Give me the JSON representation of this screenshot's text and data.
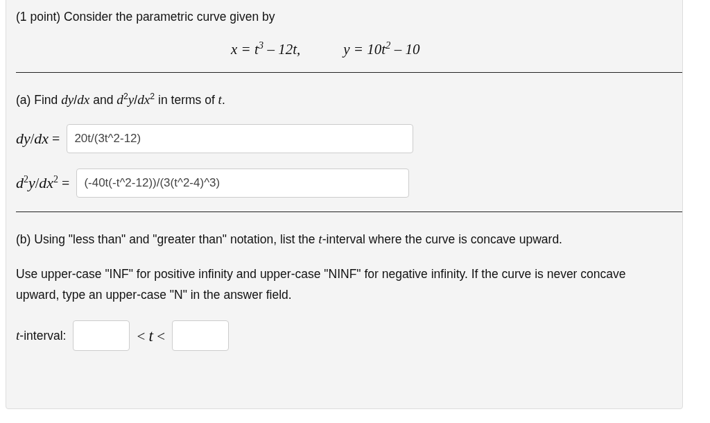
{
  "problem": {
    "intro": "(1 point) Consider the parametric curve given by",
    "equations": [
      "x = t$^{3}$ – 12t,",
      "y = 10t$^{2}$ – 10"
    ]
  },
  "part_a": {
    "prompt": "(a) Find *dy*/*dx* and *d*$^{2}$*y*/*dx*$^{2}$ in terms of *t*.",
    "answers": [
      {
        "label": "*dy*/*dx* =",
        "value": "20t/(3t^2-12)"
      },
      {
        "label": "*d*$^{2}$*y*/*dx*$^{2}$ =",
        "value": "(-40t(-t^2-12))/(3(t^2-4)^3)"
      }
    ]
  },
  "part_b": {
    "prompt": "(b) Using \"less than\" and \"greater than\" notation, list the *t*-interval where the curve is concave upward.",
    "instructions": "Use upper-case \"INF\" for positive infinity and upper-case \"NINF\" for negative infinity. If the curve is never concave upward, type an upper-case \"N\" in the answer field.",
    "interval": {
      "label": "*t*-interval:",
      "separator": "< *t* <"
    }
  }
}
